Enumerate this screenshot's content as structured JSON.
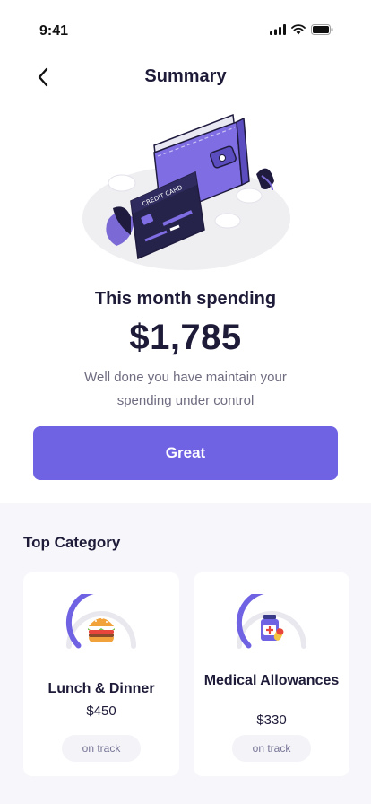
{
  "status_bar": {
    "time": "9:41"
  },
  "nav": {
    "title": "Summary"
  },
  "summary": {
    "headline": "This month spending",
    "amount": "$1,785",
    "description": "Well done you have maintain your spending under control",
    "button_label": "Great"
  },
  "illustration": {
    "card_label": "CREDIT CARD"
  },
  "categories": {
    "title": "Top Category",
    "items": [
      {
        "name": "Lunch & Dinner",
        "amount": "$450",
        "status": "on track",
        "icon": "burger-icon",
        "progress": 0.5
      },
      {
        "name": "Medical Allowances",
        "amount": "$330",
        "status": "on track",
        "icon": "medicine-icon",
        "progress": 0.5
      }
    ]
  },
  "colors": {
    "accent": "#6f62e3",
    "text": "#1e1b39",
    "muted": "#6f6c80",
    "background_alt": "#f7f7fb"
  }
}
